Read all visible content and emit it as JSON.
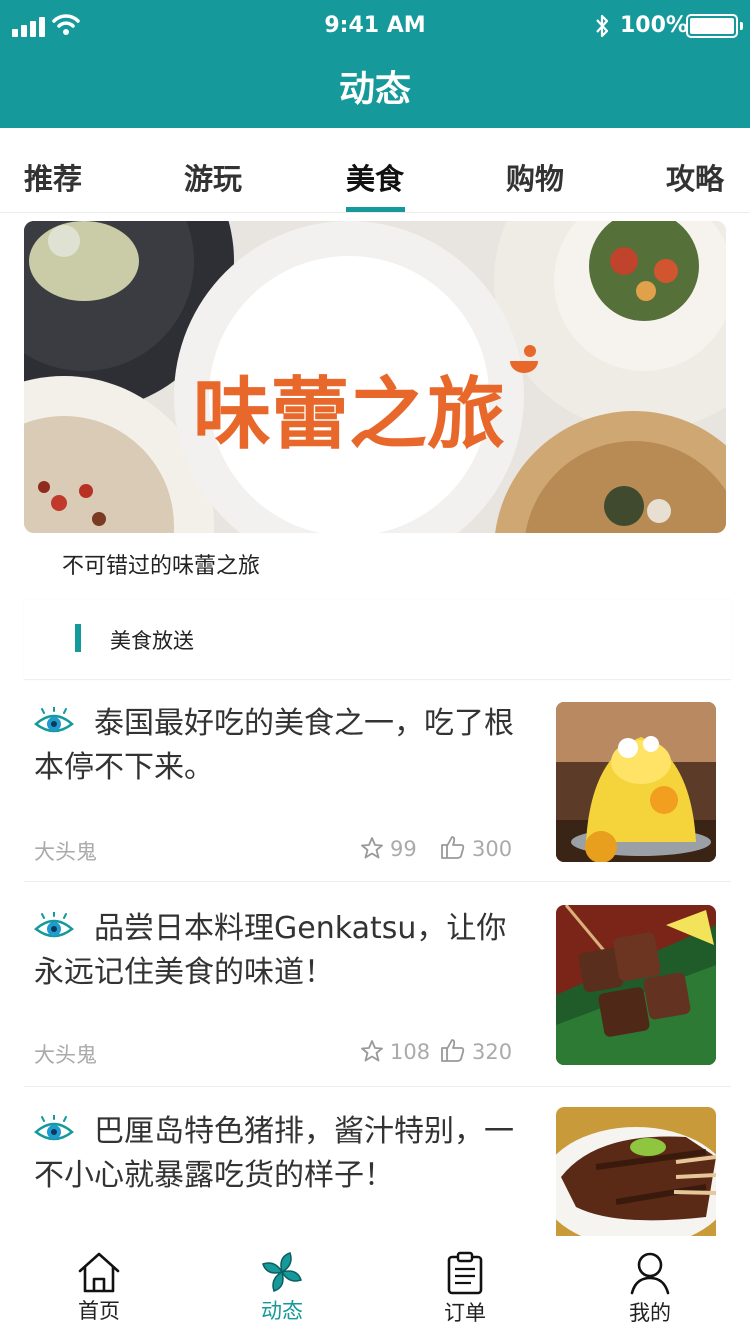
{
  "status_bar": {
    "time": "9:41 AM",
    "battery": "100%"
  },
  "header": {
    "title": "动态"
  },
  "tabs": [
    {
      "label": "推荐",
      "active": false
    },
    {
      "label": "游玩",
      "active": false
    },
    {
      "label": "美食",
      "active": true
    },
    {
      "label": "购物",
      "active": false
    },
    {
      "label": "攻略",
      "active": false
    }
  ],
  "banner": {
    "logo_text": "味蕾之旅",
    "caption": "不可错过的味蕾之旅"
  },
  "section": {
    "title": "美食放送"
  },
  "posts": [
    {
      "title": "泰国最好吃的美食之一，吃了根本停不下来。",
      "author": "大头鬼",
      "favorites": "99",
      "likes": "300",
      "image": "mango-shaved-ice"
    },
    {
      "title": "品尝日本料理Genkatsu，让你永远记住美食的味道！",
      "author": "大头鬼",
      "favorites": "108",
      "likes": "320",
      "image": "grilled-beef-skewers"
    },
    {
      "title": "巴厘岛特色猪排，酱汁特别，一不小心就暴露吃货的样子！",
      "author": "",
      "favorites": "",
      "likes": "",
      "image": "bbq-pork-ribs"
    }
  ],
  "tabbar": [
    {
      "label": "首页",
      "icon": "home-icon",
      "active": false
    },
    {
      "label": "动态",
      "icon": "pinwheel-icon",
      "active": true
    },
    {
      "label": "订单",
      "icon": "clipboard-icon",
      "active": false
    },
    {
      "label": "我的",
      "icon": "user-icon",
      "active": false
    }
  ],
  "colors": {
    "accent": "#16999a",
    "muted_text": "#aaaaaa",
    "banner_logo": "#e8672a"
  }
}
